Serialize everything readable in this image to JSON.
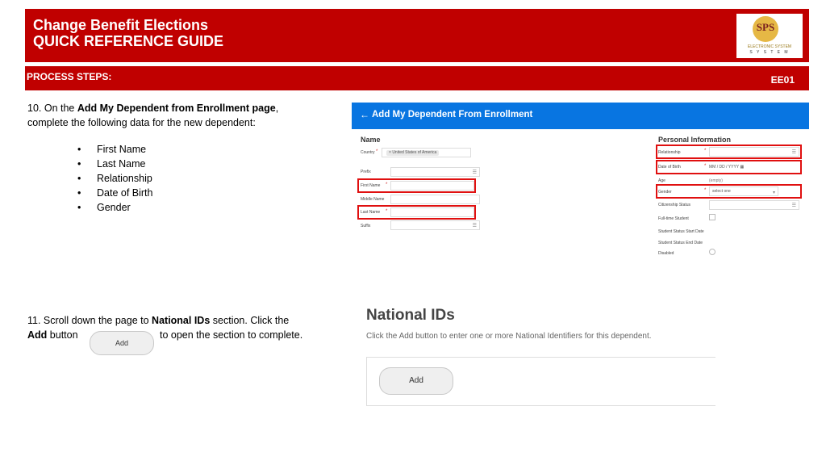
{
  "header": {
    "title_line1": "Change Benefit Elections",
    "title_line2": "QUICK REFERENCE GUIDE",
    "logo": {
      "letters": "SPS",
      "line1": "ELECTRONIC SYSTEM",
      "line2": "S Y S T E M"
    }
  },
  "process_bar": {
    "label": "PROCESS STEPS:",
    "code": "EE01"
  },
  "step10": {
    "prefix": "10.  On the ",
    "bold": "Add My Dependent from Enrollment page",
    "suffix": ",",
    "line2": "complete the following data for the new dependent:",
    "bullets": [
      "First Name",
      "Last Name",
      "Relationship",
      "Date of Birth",
      "Gender"
    ]
  },
  "step11": {
    "prefix": "11.  Scroll down the page to ",
    "bold": "National IDs",
    "suffix": " section.  Click the",
    "line2_bold": "Add",
    "line2_a": " button",
    "line2_b": "to open the section to complete.",
    "inline_button": "Add"
  },
  "workday": {
    "title": "Add My Dependent From Enrollment",
    "back_icon": "arrow-left-icon",
    "name_section": "Name",
    "country_label": "Country",
    "country_value": "United States of America",
    "prefix_label": "Prefix",
    "first_name_label": "First Name",
    "middle_name_label": "Middle Name",
    "last_name_label": "Last Name",
    "suffix_label": "Suffix",
    "personal_section": "Personal Information",
    "relationship_label": "Relationship",
    "dob_label": "Date of Birth",
    "dob_placeholder": "MM / DD / YYYY",
    "age_label": "Age",
    "age_value": "(empty)",
    "gender_label": "Gender",
    "gender_placeholder": "select one",
    "citizenship_label": "Citizenship Status",
    "fulltime_label": "Full-time Student",
    "status_start_label": "Student Status Start Date",
    "status_end_label": "Student Status End Date",
    "disabled_label": "Disabled",
    "required_mark": "*",
    "highlight_color": "#e01010",
    "bar_color": "#0875e1"
  },
  "national_ids": {
    "title": "National IDs",
    "description": "Click the Add button to enter one or more National Identifiers for this dependent.",
    "add_button": "Add"
  }
}
